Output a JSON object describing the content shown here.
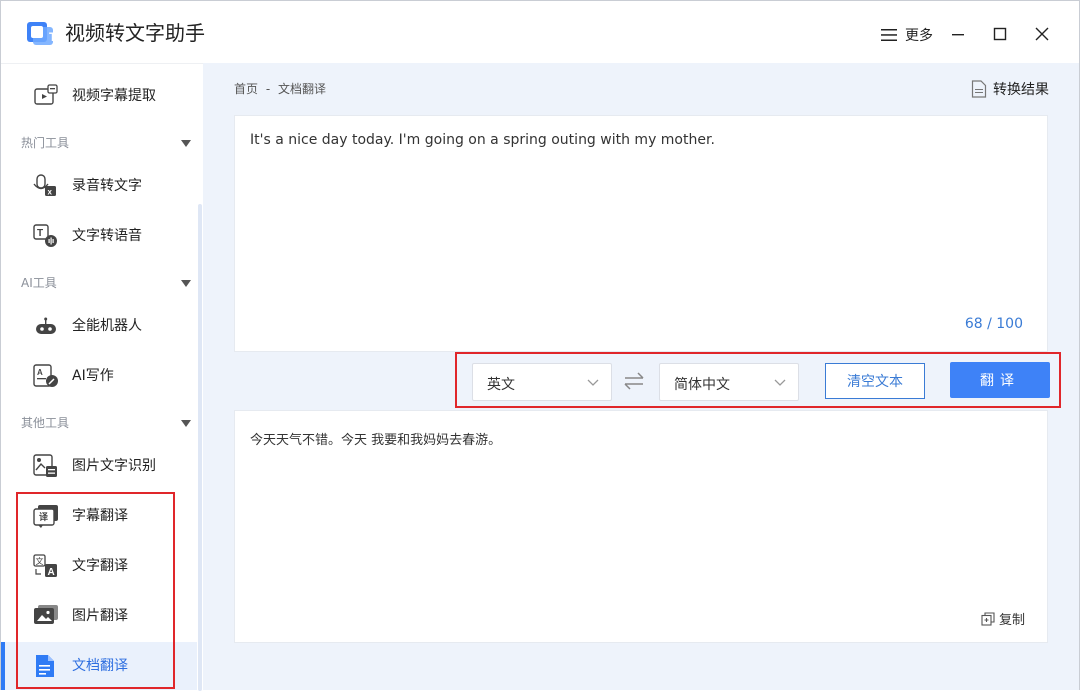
{
  "app": {
    "title": "视频转文字助手"
  },
  "titlebar": {
    "more_label": "更多"
  },
  "sidebar": {
    "top_item": {
      "label": "视频字幕提取",
      "icon": "video-subtitle-icon"
    },
    "sections": [
      {
        "label": "热门工具",
        "items": [
          {
            "label": "录音转文字",
            "icon": "mic-to-text-icon"
          },
          {
            "label": "文字转语音",
            "icon": "text-to-speech-icon"
          }
        ]
      },
      {
        "label": "AI工具",
        "items": [
          {
            "label": "全能机器人",
            "icon": "robot-icon"
          },
          {
            "label": "AI写作",
            "icon": "ai-writing-icon"
          }
        ]
      },
      {
        "label": "其他工具",
        "items": [
          {
            "label": "图片文字识别",
            "icon": "image-ocr-icon"
          },
          {
            "label": "字幕翻译",
            "icon": "subtitle-translate-icon"
          },
          {
            "label": "文字翻译",
            "icon": "text-translate-icon"
          },
          {
            "label": "图片翻译",
            "icon": "image-translate-icon"
          },
          {
            "label": "文档翻译",
            "icon": "document-translate-icon",
            "active": true
          }
        ]
      }
    ]
  },
  "main": {
    "breadcrumb": {
      "home": "首页",
      "separator": "-",
      "current": "文档翻译"
    },
    "result_link": "转换结果",
    "input": {
      "text": "It's a nice day today. I'm going on a spring outing with my mother.",
      "count": "68 / 100"
    },
    "controls": {
      "source_lang": "英文",
      "target_lang": "简体中文",
      "clear_label": "清空文本",
      "translate_label": "翻译"
    },
    "output": {
      "text": "今天天气不错。今天 我要和我妈妈去春游。",
      "copy_label": "复制"
    }
  },
  "colors": {
    "accent": "#3e82f7",
    "highlight_box": "#e0262a",
    "active_bg": "#eaf1fc"
  }
}
